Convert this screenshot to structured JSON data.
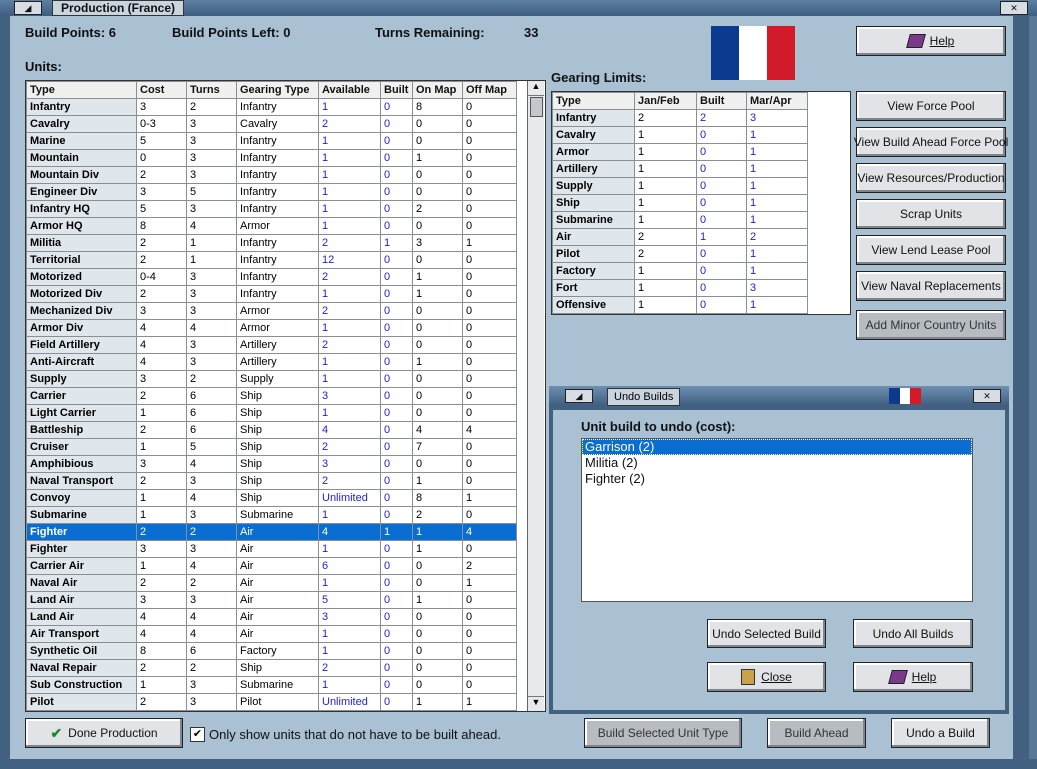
{
  "window": {
    "title": "Production (France)"
  },
  "header": {
    "build_points_label": "Build Points: 6",
    "build_points_left_label": "Build Points Left: 0",
    "turns_remaining_label": "Turns Remaining:",
    "turns_remaining_value": "33"
  },
  "units": {
    "heading": "Units:",
    "columns": [
      "Type",
      "Cost",
      "Turns",
      "Gearing Type",
      "Available",
      "Built",
      "On Map",
      "Off Map"
    ],
    "rows": [
      [
        "Infantry",
        "3",
        "2",
        "Infantry",
        "1",
        "0",
        "8",
        "0"
      ],
      [
        "Cavalry",
        "0-3",
        "3",
        "Cavalry",
        "2",
        "0",
        "0",
        "0"
      ],
      [
        "Marine",
        "5",
        "3",
        "Infantry",
        "1",
        "0",
        "0",
        "0"
      ],
      [
        "Mountain",
        "0",
        "3",
        "Infantry",
        "1",
        "0",
        "1",
        "0"
      ],
      [
        "Mountain Div",
        "2",
        "3",
        "Infantry",
        "1",
        "0",
        "0",
        "0"
      ],
      [
        "Engineer Div",
        "3",
        "5",
        "Infantry",
        "1",
        "0",
        "0",
        "0"
      ],
      [
        "Infantry HQ",
        "5",
        "3",
        "Infantry",
        "1",
        "0",
        "2",
        "0"
      ],
      [
        "Armor HQ",
        "8",
        "4",
        "Armor",
        "1",
        "0",
        "0",
        "0"
      ],
      [
        "Militia",
        "2",
        "1",
        "Infantry",
        "2",
        "1",
        "3",
        "1"
      ],
      [
        "Territorial",
        "2",
        "1",
        "Infantry",
        "12",
        "0",
        "0",
        "0"
      ],
      [
        "Motorized",
        "0-4",
        "3",
        "Infantry",
        "2",
        "0",
        "1",
        "0"
      ],
      [
        "Motorized Div",
        "2",
        "3",
        "Infantry",
        "1",
        "0",
        "1",
        "0"
      ],
      [
        "Mechanized Div",
        "3",
        "3",
        "Armor",
        "2",
        "0",
        "0",
        "0"
      ],
      [
        "Armor Div",
        "4",
        "4",
        "Armor",
        "1",
        "0",
        "0",
        "0"
      ],
      [
        "Field Artillery",
        "4",
        "3",
        "Artillery",
        "2",
        "0",
        "0",
        "0"
      ],
      [
        "Anti-Aircraft",
        "4",
        "3",
        "Artillery",
        "1",
        "0",
        "1",
        "0"
      ],
      [
        "Supply",
        "3",
        "2",
        "Supply",
        "1",
        "0",
        "0",
        "0"
      ],
      [
        "Carrier",
        "2",
        "6",
        "Ship",
        "3",
        "0",
        "0",
        "0"
      ],
      [
        "Light Carrier",
        "1",
        "6",
        "Ship",
        "1",
        "0",
        "0",
        "0"
      ],
      [
        "Battleship",
        "2",
        "6",
        "Ship",
        "4",
        "0",
        "4",
        "4"
      ],
      [
        "Cruiser",
        "1",
        "5",
        "Ship",
        "2",
        "0",
        "7",
        "0"
      ],
      [
        "Amphibious",
        "3",
        "4",
        "Ship",
        "3",
        "0",
        "0",
        "0"
      ],
      [
        "Naval Transport",
        "2",
        "3",
        "Ship",
        "2",
        "0",
        "1",
        "0"
      ],
      [
        "Convoy",
        "1",
        "4",
        "Ship",
        "Unlimited",
        "0",
        "8",
        "1"
      ],
      [
        "Submarine",
        "1",
        "3",
        "Submarine",
        "1",
        "0",
        "2",
        "0"
      ],
      [
        "Fighter",
        "2",
        "2",
        "Air",
        "4",
        "1",
        "1",
        "4"
      ],
      [
        "Fighter",
        "3",
        "3",
        "Air",
        "1",
        "0",
        "1",
        "0"
      ],
      [
        "Carrier Air",
        "1",
        "4",
        "Air",
        "6",
        "0",
        "0",
        "2"
      ],
      [
        "Naval Air",
        "2",
        "2",
        "Air",
        "1",
        "0",
        "0",
        "1"
      ],
      [
        "Land Air",
        "3",
        "3",
        "Air",
        "5",
        "0",
        "1",
        "0"
      ],
      [
        "Land Air",
        "4",
        "4",
        "Air",
        "3",
        "0",
        "0",
        "0"
      ],
      [
        "Air Transport",
        "4",
        "4",
        "Air",
        "1",
        "0",
        "0",
        "0"
      ],
      [
        "Synthetic Oil",
        "8",
        "6",
        "Factory",
        "1",
        "0",
        "0",
        "0"
      ],
      [
        "Naval Repair",
        "2",
        "2",
        "Ship",
        "2",
        "0",
        "0",
        "0"
      ],
      [
        "Sub Construction",
        "1",
        "3",
        "Submarine",
        "1",
        "0",
        "0",
        "0"
      ],
      [
        "Pilot",
        "2",
        "3",
        "Pilot",
        "Unlimited",
        "0",
        "1",
        "1"
      ]
    ],
    "selected_row_index": 25
  },
  "gearing": {
    "heading": "Gearing Limits:",
    "columns": [
      "Type",
      "Jan/Feb",
      "Built",
      "Mar/Apr"
    ],
    "rows": [
      [
        "Infantry",
        "2",
        "2",
        "3"
      ],
      [
        "Cavalry",
        "1",
        "0",
        "1"
      ],
      [
        "Armor",
        "1",
        "0",
        "1"
      ],
      [
        "Artillery",
        "1",
        "0",
        "1"
      ],
      [
        "Supply",
        "1",
        "0",
        "1"
      ],
      [
        "Ship",
        "1",
        "0",
        "1"
      ],
      [
        "Submarine",
        "1",
        "0",
        "1"
      ],
      [
        "Air",
        "2",
        "1",
        "2"
      ],
      [
        "Pilot",
        "2",
        "0",
        "1"
      ],
      [
        "Factory",
        "1",
        "0",
        "1"
      ],
      [
        "Fort",
        "1",
        "0",
        "3"
      ],
      [
        "Offensive",
        "1",
        "0",
        "1"
      ]
    ]
  },
  "right_buttons": {
    "help": "Help",
    "view_force_pool": "View Force Pool",
    "view_build_ahead": "View Build Ahead Force Pool",
    "view_resources": "View Resources/Production",
    "scrap_units": "Scrap Units",
    "view_lend_lease": "View Lend Lease Pool",
    "view_naval_replacements": "View Naval Replacements",
    "add_minor": "Add Minor Country Units"
  },
  "undo_window": {
    "title": "Undo Builds",
    "heading": "Unit build to undo (cost):",
    "items": [
      "Garrison (2)",
      "Militia (2)",
      "Fighter (2)"
    ],
    "selected_index": 0,
    "undo_selected": "Undo Selected Build",
    "undo_all": "Undo All Builds",
    "close": "Close",
    "help": "Help"
  },
  "bottom": {
    "done_production": "Done Production",
    "checkbox_label": "Only show units that do not have to be built ahead.",
    "checkbox_checked": true,
    "build_selected": "Build Selected Unit Type",
    "build_ahead": "Build Ahead",
    "undo_a_build": "Undo a Build"
  },
  "flag_colors": [
    "#0b3a8f",
    "#ffffff",
    "#d21a2a"
  ]
}
